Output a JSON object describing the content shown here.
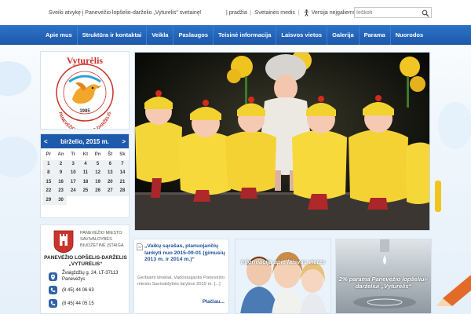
{
  "header": {
    "welcome": "Sveiki atvykę į Panevėžio lopšelio-darželio „Vyturėlis“ svetainę!",
    "links": [
      "| pradžia",
      "Svetainės medis",
      "Versija neįgaliems"
    ],
    "search_placeholder": "Ieškoti"
  },
  "nav": {
    "items": [
      "Apie mus",
      "Struktūra ir kontaktai",
      "Veikla",
      "Paslaugos",
      "Teisinė informacija",
      "Laisvos vietos",
      "Galerija",
      "Parama",
      "Nuorodos"
    ]
  },
  "logo": {
    "name": "Vyturėlis",
    "ring_text": "PANEVĖŽIO LOPŠELIS-DARŽELIS",
    "year": "1985"
  },
  "calendar": {
    "prev": "<",
    "next": ">",
    "month": "birželio, 2015 m.",
    "weekdays": [
      "Pr",
      "An",
      "Tr",
      "Kt",
      "Pn",
      "Št",
      "Sk"
    ],
    "days": [
      "1",
      "2",
      "3",
      "4",
      "5",
      "6",
      "7",
      "8",
      "9",
      "10",
      "11",
      "12",
      "13",
      "14",
      "15",
      "16",
      "17",
      "18",
      "19",
      "20",
      "21",
      "22",
      "23",
      "24",
      "25",
      "26",
      "27",
      "28",
      "29",
      "30",
      "",
      "",
      "",
      "",
      ""
    ]
  },
  "institution": {
    "subtitle_lines": [
      "PANEVĖŽIO MIESTO",
      "SAVIVALDYBĖS",
      "BIUDŽETINĖ ĮSTAIGA"
    ],
    "name_lines": [
      "PANEVĖŽIO LOPŠELIS-DARŽELIS",
      "„VYTURĖLIS“"
    ],
    "address_lines": [
      "Žvaigždžių g. 24, LT-37113",
      "Panevėžys"
    ],
    "phone1": "(8 45) 44 06 63",
    "phone2": "(8 45) 44 05 15"
  },
  "news": {
    "title": "„Vaikų sąrašas, planuojančių lankyti nuo 2015-09-01 (gimusių 2013 m. ir 2014 m.)“",
    "excerpt": "Gerbiami tėveliai, Vadovaujantis Panevėžio miesto Savivaldybės tarybos 2015 m. [...]",
    "more": "Plačiau..."
  },
  "cards": [
    {
      "caption": "Informacija apie laisvas vietas"
    },
    {
      "caption": "2% parama Panevėžio lopšeliui-darželiui „Vyturėlis“"
    }
  ],
  "colors": {
    "nav": "#1d59ad",
    "calendar_header": "#1e5aab",
    "link": "#1d4f97",
    "logo_red": "#c8342b",
    "costume_yellow": "#f5d638"
  }
}
